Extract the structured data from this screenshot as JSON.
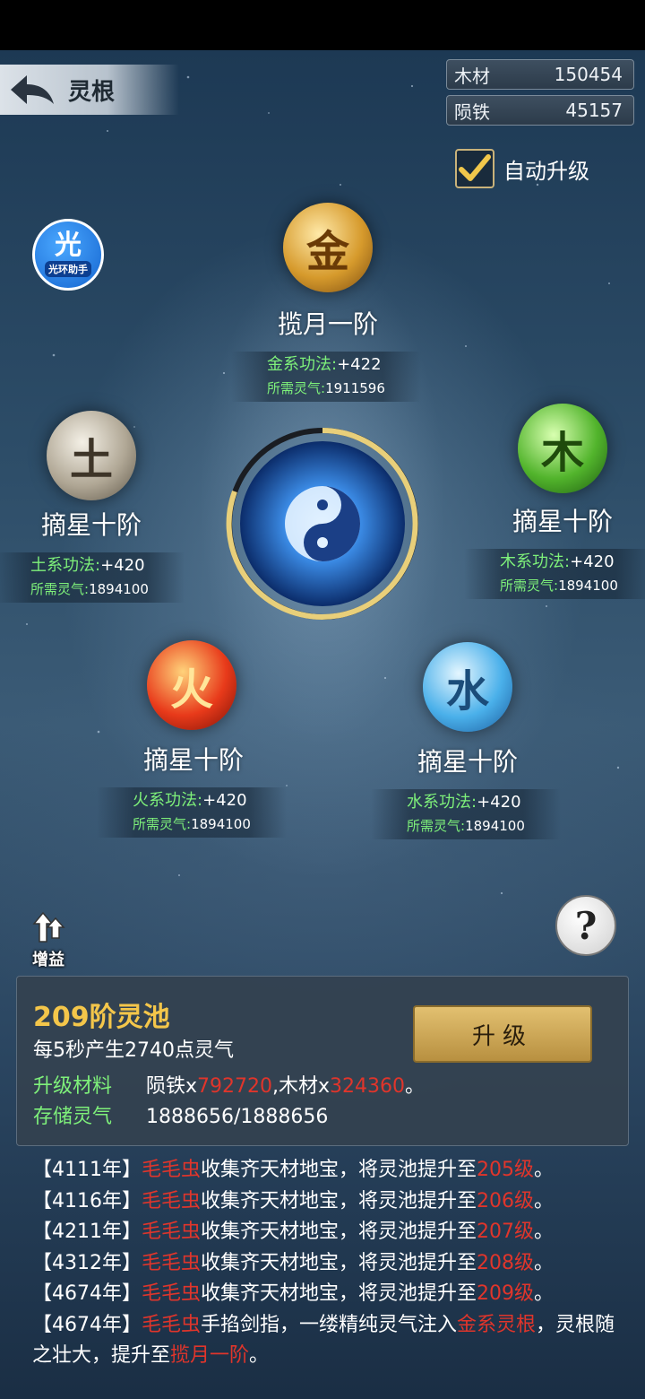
{
  "header": {
    "title": "灵根"
  },
  "resources": [
    {
      "name": "木材",
      "value": "150454"
    },
    {
      "name": "陨铁",
      "value": "45157"
    }
  ],
  "auto_upgrade": {
    "label": "自动升级",
    "checked": true
  },
  "helper": {
    "big": "光",
    "small": "光环助手"
  },
  "elements": {
    "gold": {
      "glyph": "金",
      "rank": "揽月一阶",
      "skill_label": "金系功法:",
      "skill_value": "+422",
      "req_label": "所需灵气:",
      "req_value": "1911596"
    },
    "earth": {
      "glyph": "土",
      "rank": "摘星十阶",
      "skill_label": "土系功法:",
      "skill_value": "+420",
      "req_label": "所需灵气:",
      "req_value": "1894100"
    },
    "wood": {
      "glyph": "木",
      "rank": "摘星十阶",
      "skill_label": "木系功法:",
      "skill_value": "+420",
      "req_label": "所需灵气:",
      "req_value": "1894100"
    },
    "fire": {
      "glyph": "火",
      "rank": "摘星十阶",
      "skill_label": "火系功法:",
      "skill_value": "+420",
      "req_label": "所需灵气:",
      "req_value": "1894100"
    },
    "water": {
      "glyph": "水",
      "rank": "摘星十阶",
      "skill_label": "水系功法:",
      "skill_value": "+420",
      "req_label": "所需灵气:",
      "req_value": "1894100"
    }
  },
  "boost": {
    "label": "增益"
  },
  "help": {
    "label": "?"
  },
  "pool": {
    "title": "209阶灵池",
    "rate": "每5秒产生2740点灵气",
    "material_label": "升级材料",
    "material_a": "陨铁x",
    "material_a_qty": "792720",
    "material_sep": ",木材x",
    "material_b_qty": "324360",
    "material_end": "。",
    "storage_label": "存储灵气",
    "storage_value": "1888656/1888656",
    "upgrade_label": "升级"
  },
  "log": [
    {
      "year": "【4111年】",
      "who": "毛毛虫",
      "text": "收集齐天材地宝，将灵池提升至",
      "target": "205级",
      "end": "。"
    },
    {
      "year": "【4116年】",
      "who": "毛毛虫",
      "text": "收集齐天材地宝，将灵池提升至",
      "target": "206级",
      "end": "。"
    },
    {
      "year": "【4211年】",
      "who": "毛毛虫",
      "text": "收集齐天材地宝，将灵池提升至",
      "target": "207级",
      "end": "。"
    },
    {
      "year": "【4312年】",
      "who": "毛毛虫",
      "text": "收集齐天材地宝，将灵池提升至",
      "target": "208级",
      "end": "。"
    },
    {
      "year": "【4674年】",
      "who": "毛毛虫",
      "text": "收集齐天材地宝，将灵池提升至",
      "target": "209级",
      "end": "。"
    },
    {
      "year": "【4674年】",
      "who": "毛毛虫",
      "text": "手掐剑指，一缕精纯灵气注入",
      "target": "金系灵根",
      "mid": "，灵根随之壮大，提升至",
      "target2": "揽月一阶",
      "end": "。"
    }
  ],
  "colors": {
    "accent_gold": "#f4c64a",
    "stat_green": "#7ef07a",
    "highlight_red": "#e0352b"
  }
}
